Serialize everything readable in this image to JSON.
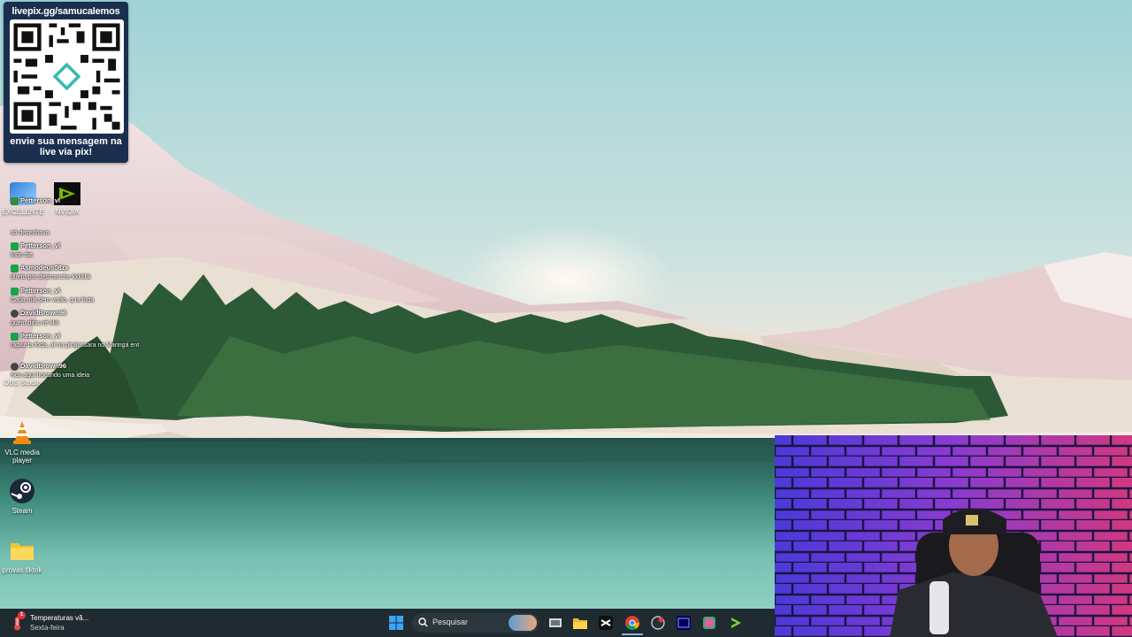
{
  "pix_widget": {
    "url": "livepix.gg/samucalemos",
    "message_line1": "envie sua mensagem na",
    "message_line2": "live via pix!"
  },
  "desktop_icons": [
    {
      "label": "VLC media player",
      "icon": "vlc-cone-icon"
    },
    {
      "label": "Steam",
      "icon": "steam-icon"
    },
    {
      "label": "provas tiktok",
      "icon": "folder-icon"
    },
    {
      "label": "EXCELENTE",
      "icon": "app-icon"
    },
    {
      "label": "NVIDIA",
      "icon": "nvidia-icon"
    },
    {
      "label": "OBS Studio",
      "icon": "obs-icon"
    }
  ],
  "chat": [
    {
      "user": "Petterson_vl",
      "message": "só desenhava"
    },
    {
      "user": "Petterson_vl",
      "message": "todo dia"
    },
    {
      "user": "Asmodeus08zx",
      "message": "direto pro desmanche kkkkkk"
    },
    {
      "user": "Petterson_vl",
      "message": "Cada mlk sem visão, q ta foda"
    },
    {
      "user": "DavidBrown96",
      "message": "quem diria né kkk"
    },
    {
      "user": "Petterson_vl",
      "message": "rapaz ta foda, aí no pirajussara no Maringá ent"
    },
    {
      "user": "DavidBrown96",
      "message": "Nós aqui trocando uma ideia"
    }
  ],
  "taskbar": {
    "weather_title": "Temperaturas vã...",
    "weather_subtitle": "Sexta-feira",
    "weather_badge": "1",
    "search_placeholder": "Pesquisar",
    "apps": [
      "start-icon",
      "search-icon",
      "widgets-icon",
      "task-view-icon",
      "file-explorer-icon",
      "capcut-icon",
      "chrome-icon",
      "app-red-icon",
      "premiere-icon",
      "app-green-icon",
      "arrow-app-icon"
    ]
  }
}
